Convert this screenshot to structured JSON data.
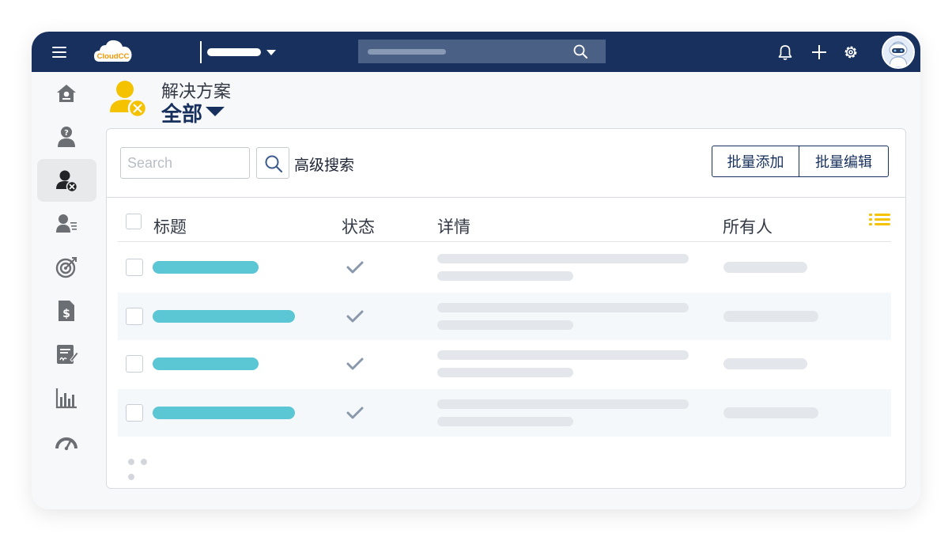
{
  "brand": {
    "logo_text": "CloudCC",
    "nav_color": "#17305d",
    "accent_color": "#f5c200",
    "link_bar_color": "#5bc6d4"
  },
  "topbar": {
    "menu_icon": "hamburger-menu-icon",
    "search_icon": "search-icon",
    "actions": [
      "bell-icon",
      "plus-icon",
      "gear-icon",
      "user-avatar"
    ]
  },
  "sidebar": {
    "items": [
      {
        "icon": "home-icon",
        "active": false
      },
      {
        "icon": "question-person-icon",
        "active": false
      },
      {
        "icon": "solutions-icon",
        "active": true
      },
      {
        "icon": "contact-list-icon",
        "active": false
      },
      {
        "icon": "target-icon",
        "active": false
      },
      {
        "icon": "invoice-dollar-icon",
        "active": false
      },
      {
        "icon": "sign-document-icon",
        "active": false
      },
      {
        "icon": "bar-chart-icon",
        "active": false
      },
      {
        "icon": "gauge-icon",
        "active": false
      }
    ]
  },
  "page": {
    "object_label": "解决方案",
    "view_name": "全部",
    "object_icon": "solutions-icon"
  },
  "toolbar": {
    "search_placeholder": "Search",
    "search_value": "",
    "advanced_search": "高级搜索",
    "bulk_add": "批量添加",
    "bulk_edit": "批量编辑"
  },
  "table": {
    "columns": [
      "标题",
      "状态",
      "详情",
      "所有人"
    ],
    "settings_icon": "list-settings-icon",
    "rows": [
      {
        "status_icon": "checkmark-icon",
        "placeholder": true
      },
      {
        "status_icon": "checkmark-icon",
        "placeholder": true
      },
      {
        "status_icon": "checkmark-icon",
        "placeholder": true
      },
      {
        "status_icon": "checkmark-icon",
        "placeholder": true
      }
    ],
    "more_indicator": "more-dots-icon"
  }
}
